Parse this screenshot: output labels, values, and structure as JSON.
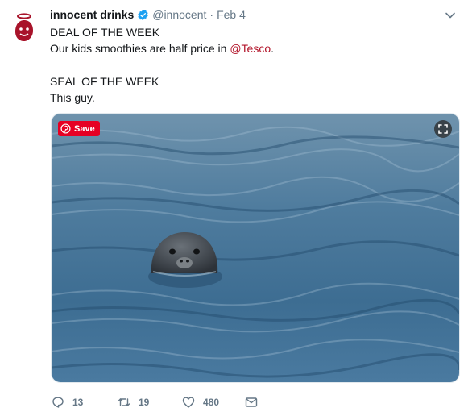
{
  "tweet": {
    "author": {
      "display_name": "innocent drinks",
      "handle": "@innocent",
      "verified": true,
      "avatar_icon": "innocent-logo-icon"
    },
    "separator": "·",
    "date": "Feb 4",
    "lines": {
      "line1": "DEAL OF THE WEEK",
      "line2_prefix": "Our kids smoothies are half price in ",
      "line2_mention": "@Tesco",
      "line2_suffix": ".",
      "line3": "SEAL OF THE WEEK",
      "line4": "This guy."
    },
    "media": {
      "save_label": "Save",
      "save_icon": "pinterest-icon",
      "expand_icon": "expand-icon"
    },
    "actions": {
      "reply_count": "13",
      "retweet_count": "19",
      "like_count": "480"
    }
  },
  "colors": {
    "mention": "#b3162b",
    "pinterest": "#e60023",
    "muted": "#657786",
    "water": "#3f6f93"
  }
}
